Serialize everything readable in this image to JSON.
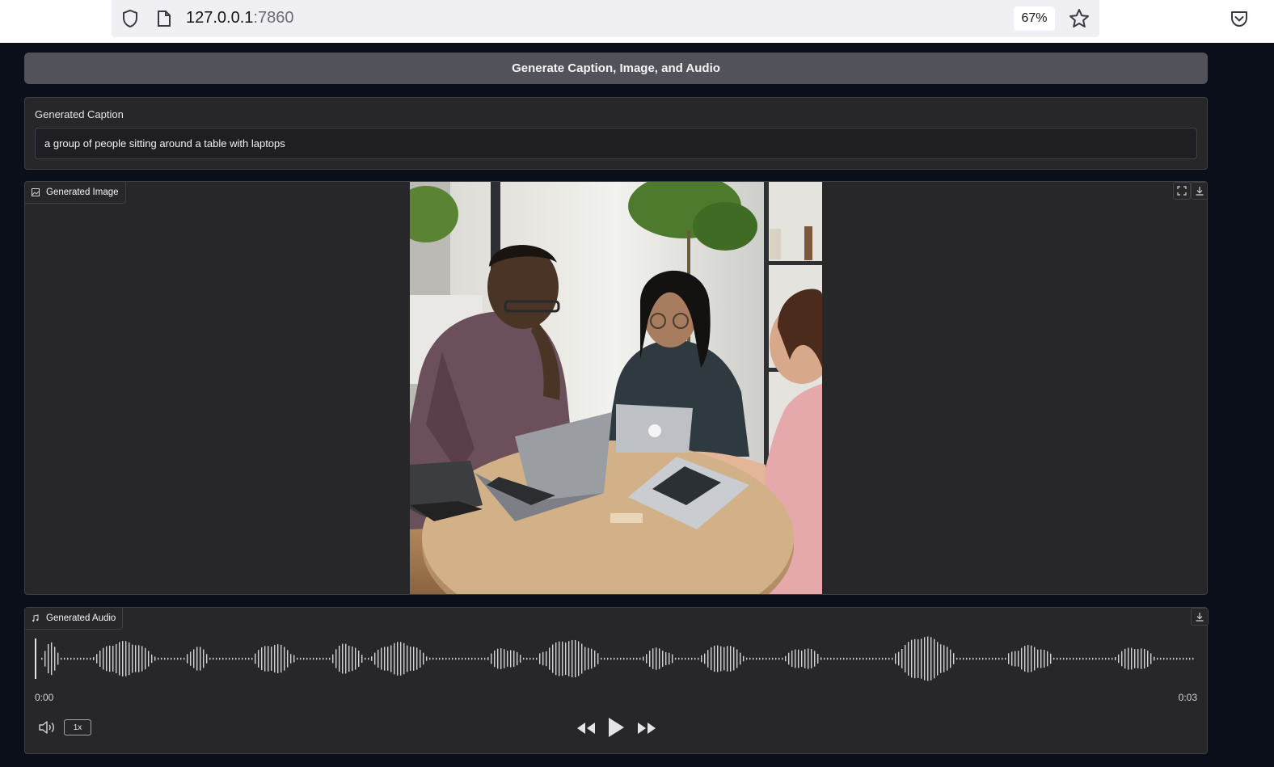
{
  "browser": {
    "url_host": "127.0.0.1",
    "url_port": ":7860",
    "zoom": "67%"
  },
  "app": {
    "generate_button": "Generate Caption, Image, and Audio",
    "caption": {
      "label": "Generated Caption",
      "value": "a group of people sitting around a table with laptops"
    },
    "image": {
      "label": "Generated Image",
      "icons": [
        "image-icon",
        "fullscreen-icon",
        "download-icon"
      ]
    },
    "audio": {
      "label": "Generated Audio",
      "current_time": "0:00",
      "duration": "0:03",
      "speed": "1x",
      "icons": [
        "music-icon",
        "download-icon",
        "volume-icon",
        "rewind-icon",
        "play-icon",
        "fast-forward-icon"
      ]
    }
  }
}
